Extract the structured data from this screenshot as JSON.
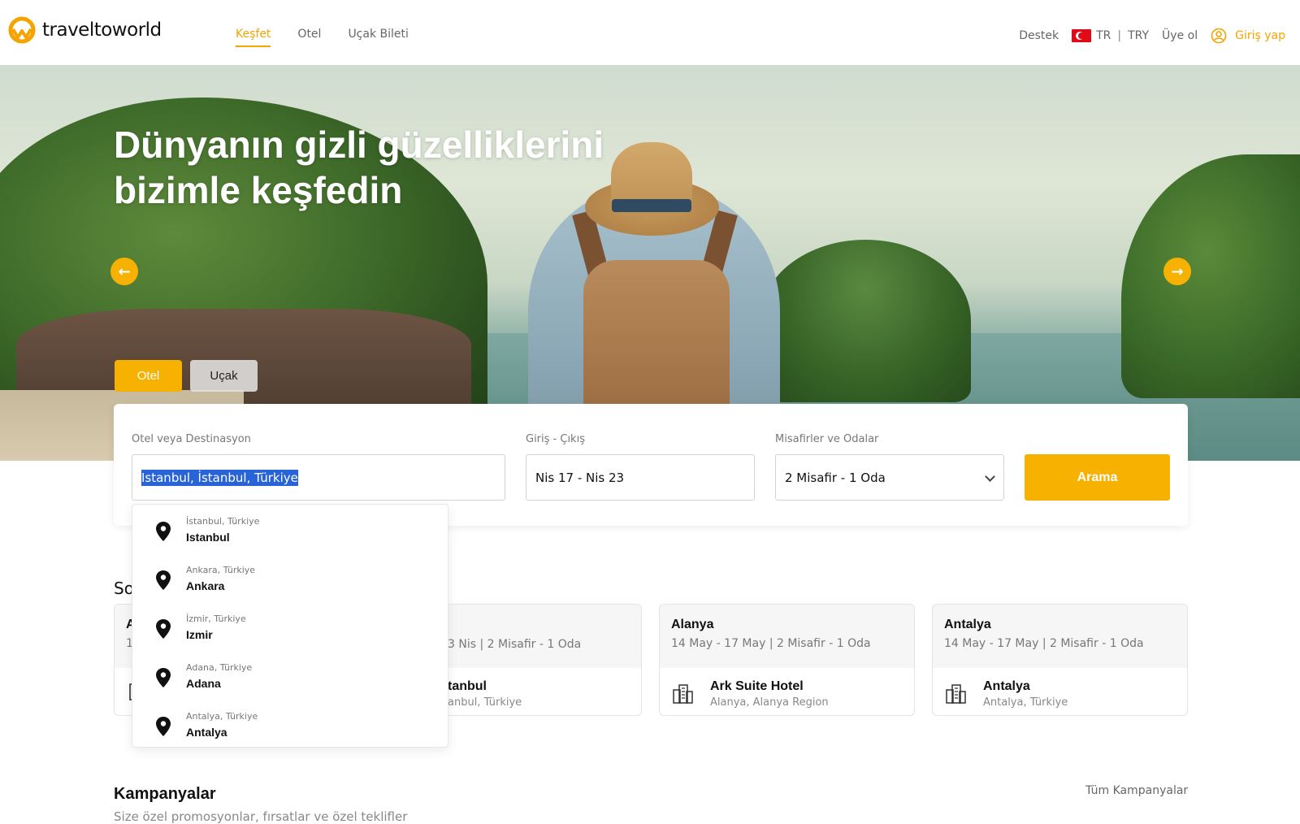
{
  "header": {
    "logo_text": "traveltoworld",
    "nav": [
      {
        "label": "Keşfet",
        "active": true
      },
      {
        "label": "Otel",
        "active": false
      },
      {
        "label": "Uçak Bileti",
        "active": false
      }
    ],
    "support": "Destek",
    "language": "TR",
    "currency": "TRY",
    "signup": "Üye ol",
    "login": "Giriş yap"
  },
  "hero": {
    "title_line1": "Dünyanın gizli güzelliklerini",
    "title_line2": "bizimle keşfedin",
    "prev_icon": "arrow-left-icon",
    "next_icon": "arrow-right-icon"
  },
  "search_tabs": {
    "hotel": "Otel",
    "flight": "Uçak"
  },
  "search": {
    "destination_label": "Otel veya Destinasyon",
    "destination_value": "Istanbul, İstanbul, Türkiye",
    "dates_label": "Giriş - Çıkış",
    "dates_value": "Nis 17 - Nis 23",
    "guests_label": "Misafirler ve Odalar",
    "guests_value": "2 Misafir - 1 Oda",
    "search_button": "Arama"
  },
  "dropdown": {
    "items": [
      {
        "sub": "İstanbul, Türkiye",
        "main": "Istanbul"
      },
      {
        "sub": "Ankara, Türkiye",
        "main": "Ankara"
      },
      {
        "sub": "İzmir, Türkiye",
        "main": "Izmir"
      },
      {
        "sub": "Adana, Türkiye",
        "main": "Adana"
      },
      {
        "sub": "Antalya, Türkiye",
        "main": "Antalya"
      }
    ]
  },
  "recent": {
    "section_title_partial": "So",
    "cards": [
      {
        "city": "A",
        "meta": "1",
        "hotel": "",
        "location": ""
      },
      {
        "city": "",
        "meta": "3 Nis | 2 Misafir - 1 Oda",
        "hotel": "tanbul",
        "location": "anbul, Türkiye"
      },
      {
        "city": "Alanya",
        "meta": "14 May - 17 May | 2 Misafir - 1 Oda",
        "hotel": "Ark Suite Hotel",
        "location": "Alanya, Alanya Region"
      },
      {
        "city": "Antalya",
        "meta": "14 May - 17 May | 2 Misafir - 1 Oda",
        "hotel": "Antalya",
        "location": "Antalya, Türkiye"
      }
    ]
  },
  "campaigns": {
    "title": "Kampanyalar",
    "subtitle": "Size özel promosyonlar, fırsatlar ve özel teklifler",
    "all_link": "Tüm Kampanyalar"
  },
  "colors": {
    "accent": "#f7b100",
    "selection": "#2864d8"
  }
}
